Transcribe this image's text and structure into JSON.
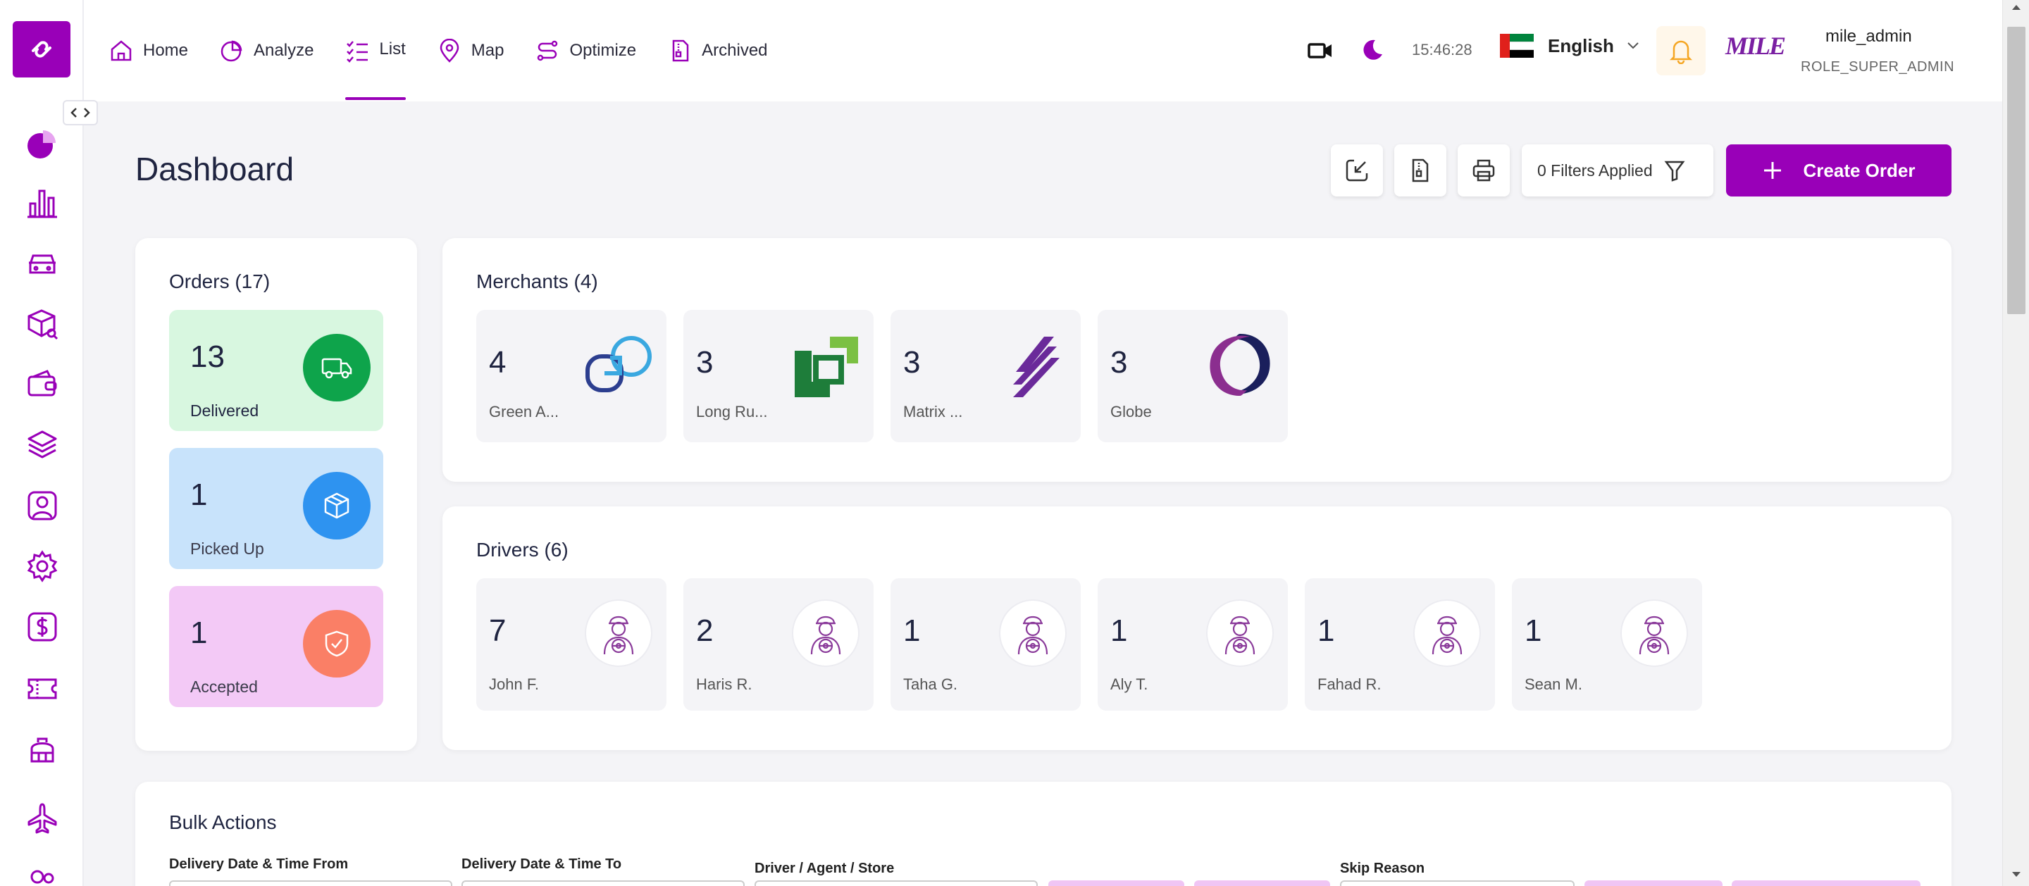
{
  "nav": {
    "items": [
      {
        "label": "Home",
        "icon": "home-icon"
      },
      {
        "label": "Analyze",
        "icon": "pie-icon"
      },
      {
        "label": "List",
        "icon": "list-icon",
        "active": true
      },
      {
        "label": "Map",
        "icon": "map-pin-icon"
      },
      {
        "label": "Optimize",
        "icon": "route-icon"
      },
      {
        "label": "Archived",
        "icon": "archive-icon"
      }
    ]
  },
  "topbar": {
    "clock": "15:46:28",
    "language": "English",
    "brand": "MILE",
    "user_name": "mile_admin",
    "user_role": "ROLE_SUPER_ADMIN"
  },
  "header": {
    "title": "Dashboard",
    "filters_label": "0 Filters Applied",
    "create_label": "Create Order"
  },
  "orders": {
    "title": "Orders (17)",
    "stats": [
      {
        "count": "13",
        "label": "Delivered",
        "color": "#0ea44b",
        "bg": "#d8f7e0"
      },
      {
        "count": "1",
        "label": "Picked Up",
        "color": "#2e93f0",
        "bg": "#c8e3fb"
      },
      {
        "count": "1",
        "label": "Accepted",
        "color": "#fa7f66",
        "bg": "#f3c9f6"
      }
    ]
  },
  "merchants": {
    "title": "Merchants (4)",
    "items": [
      {
        "count": "4",
        "name": "Green A..."
      },
      {
        "count": "3",
        "name": "Long Ru..."
      },
      {
        "count": "3",
        "name": "Matrix ..."
      },
      {
        "count": "3",
        "name": "Globe"
      }
    ]
  },
  "drivers": {
    "title": "Drivers (6)",
    "items": [
      {
        "count": "7",
        "name": "John F."
      },
      {
        "count": "2",
        "name": "Haris R."
      },
      {
        "count": "1",
        "name": "Taha G."
      },
      {
        "count": "1",
        "name": "Aly T."
      },
      {
        "count": "1",
        "name": "Fahad R."
      },
      {
        "count": "1",
        "name": "Sean M."
      }
    ]
  },
  "bulk": {
    "title": "Bulk Actions",
    "labels": {
      "date_from": "Delivery Date & Time From",
      "date_to": "Delivery Date & Time To",
      "driver": "Driver / Agent / Store",
      "skip": "Skip Reason"
    }
  },
  "colors": {
    "accent": "#9900b8"
  }
}
